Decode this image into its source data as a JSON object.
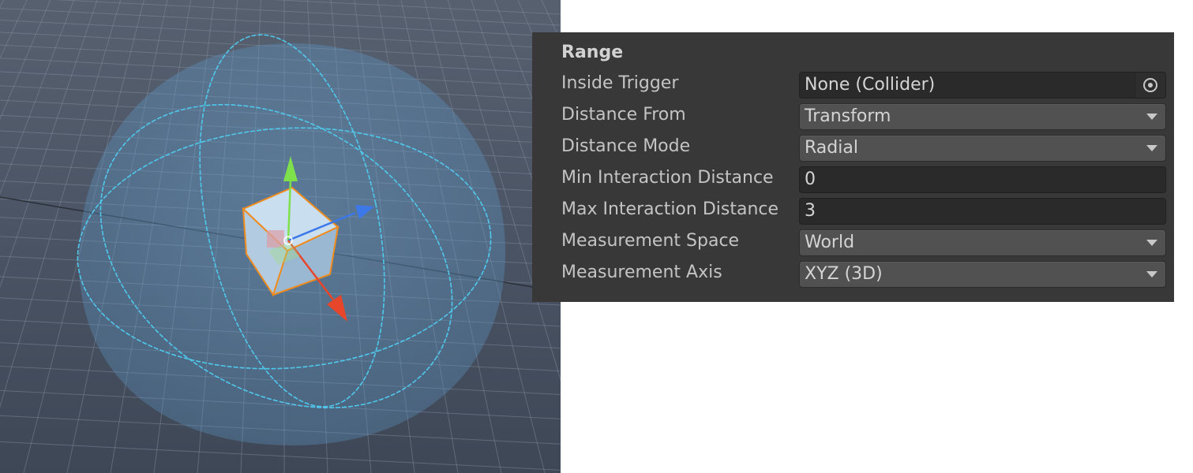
{
  "inspector": {
    "section_title": "Range",
    "fields": {
      "inside_trigger": {
        "label": "Inside Trigger",
        "value": "None (Collider)"
      },
      "distance_from": {
        "label": "Distance From",
        "value": "Transform"
      },
      "distance_mode": {
        "label": "Distance Mode",
        "value": "Radial"
      },
      "min_interaction_distance": {
        "label": "Min Interaction Distance",
        "value": "0"
      },
      "max_interaction_distance": {
        "label": "Max Interaction Distance",
        "value": "3"
      },
      "measurement_space": {
        "label": "Measurement Space",
        "value": "World"
      },
      "measurement_axis": {
        "label": "Measurement Axis",
        "value": "XYZ (3D)"
      }
    }
  },
  "scene": {
    "gizmo_colors": {
      "sphere_wire": "#4fc8ec",
      "x_axis": "#e8462a",
      "y_axis": "#7ee04a",
      "z_axis": "#3d78e8",
      "selection": "#f08c1e"
    },
    "icons": [
      "target-picker-icon",
      "dropdown-arrow-icon"
    ]
  }
}
